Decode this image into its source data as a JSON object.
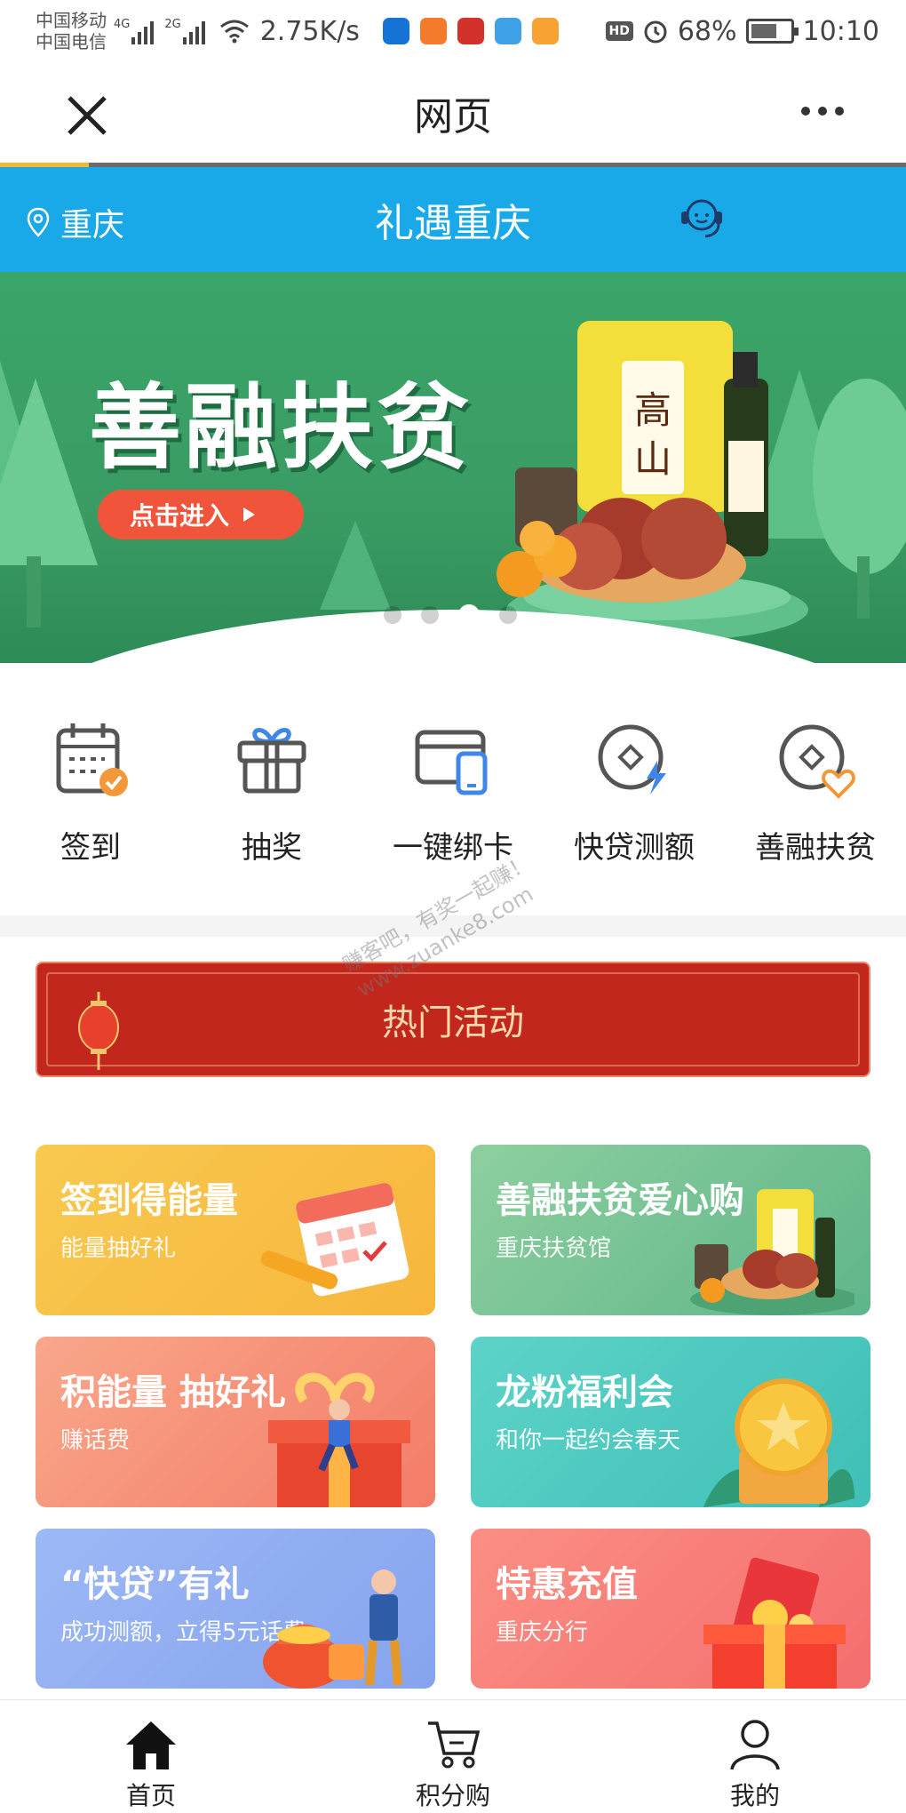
{
  "status_bar": {
    "carrier_1": "中国移动",
    "carrier_2": "中国电信",
    "net_1": "4G",
    "net_2": "2G",
    "speed": "2.75K/s",
    "hd": "HD",
    "battery": "68%",
    "time": "10:10"
  },
  "header": {
    "title": "网页"
  },
  "bluebar": {
    "location": "重庆",
    "title": "礼遇重庆"
  },
  "banner": {
    "title": "善融扶贫",
    "button": "点击进入",
    "slide_count": 4,
    "active_slide": 3
  },
  "quick_nav": [
    {
      "label": "签到",
      "icon": "calendar-check-icon"
    },
    {
      "label": "抽奖",
      "icon": "gift-icon"
    },
    {
      "label": "一键绑卡",
      "icon": "bind-card-icon"
    },
    {
      "label": "快贷测额",
      "icon": "loan-quota-icon"
    },
    {
      "label": "善融扶贫",
      "icon": "poverty-aid-icon"
    }
  ],
  "hot": {
    "title": "热门活动"
  },
  "cards": [
    {
      "title": "签到得能量",
      "subtitle": "能量抽好礼"
    },
    {
      "title": "善融扶贫爱心购",
      "subtitle": "重庆扶贫馆"
    },
    {
      "title": "积能量 抽好礼",
      "subtitle": "赚话费"
    },
    {
      "title": "龙粉福利会",
      "subtitle": "和你一起约会春天"
    },
    {
      "title": "“快贷”有礼",
      "subtitle": "成功测额，立得5元话费"
    },
    {
      "title": "特惠充值",
      "subtitle": "重庆分行"
    }
  ],
  "watermark": {
    "line1": "赚客吧，有奖一起赚！",
    "line2": "www.zuanke8.com"
  },
  "bottom_nav": [
    {
      "label": "首页",
      "icon": "home-icon"
    },
    {
      "label": "积分购",
      "icon": "cart-icon"
    },
    {
      "label": "我的",
      "icon": "user-icon"
    }
  ],
  "colors": {
    "blue_bar": "#1aa9e8",
    "banner_green": "#3aa569",
    "hot_red": "#c1271d",
    "button_red": "#f0553b"
  }
}
